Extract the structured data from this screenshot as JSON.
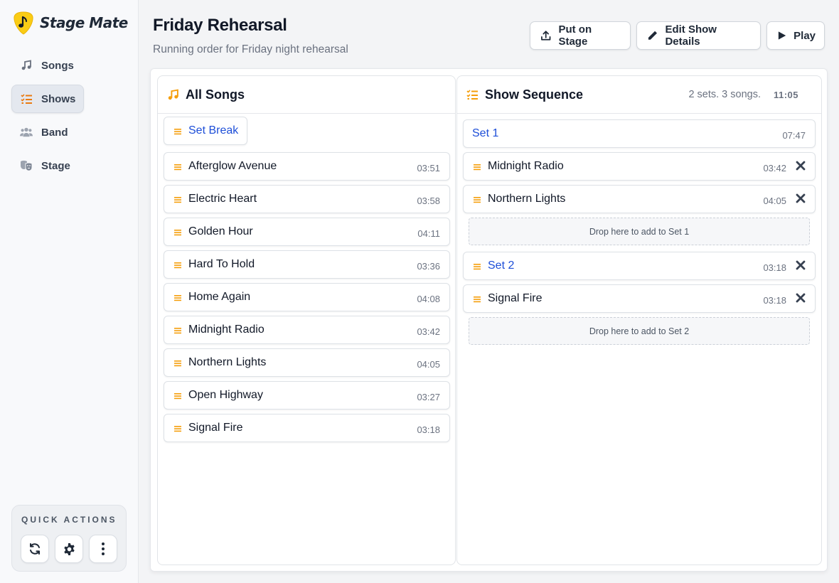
{
  "app": {
    "name": "Stage Mate"
  },
  "sidebar": {
    "items": [
      {
        "label": "Songs",
        "icon": "music-note-icon",
        "active": false
      },
      {
        "label": "Shows",
        "icon": "list-check-icon",
        "active": true
      },
      {
        "label": "Band",
        "icon": "users-icon",
        "active": false
      },
      {
        "label": "Stage",
        "icon": "theater-masks-icon",
        "active": false
      }
    ],
    "quick_actions": {
      "title": "QUICK ACTIONS",
      "buttons": [
        "refresh-icon",
        "gear-icon",
        "more-vertical-icon"
      ]
    }
  },
  "header": {
    "title": "Friday Rehearsal",
    "subtitle": "Running order for Friday night rehearsal",
    "buttons": [
      {
        "label": "Put on Stage",
        "icon": "upload-icon"
      },
      {
        "label": "Edit Show Details",
        "icon": "pencil-icon"
      },
      {
        "label": "Play",
        "icon": "play-icon"
      }
    ]
  },
  "all_songs": {
    "title": "All Songs",
    "set_break_label": "Set Break",
    "songs": [
      {
        "title": "Afterglow Avenue",
        "duration": "03:51"
      },
      {
        "title": "Electric Heart",
        "duration": "03:58"
      },
      {
        "title": "Golden Hour",
        "duration": "04:11"
      },
      {
        "title": "Hard To Hold",
        "duration": "03:36"
      },
      {
        "title": "Home Again",
        "duration": "04:08"
      },
      {
        "title": "Midnight Radio",
        "duration": "03:42"
      },
      {
        "title": "Northern Lights",
        "duration": "04:05"
      },
      {
        "title": "Open Highway",
        "duration": "03:27"
      },
      {
        "title": "Signal Fire",
        "duration": "03:18"
      }
    ]
  },
  "show_sequence": {
    "title": "Show Sequence",
    "summary": "2 sets. 3 songs.",
    "total": "11:05",
    "sets": [
      {
        "label": "Set 1",
        "duration": "07:47",
        "songs": [
          {
            "title": "Midnight Radio",
            "duration": "03:42"
          },
          {
            "title": "Northern Lights",
            "duration": "04:05"
          }
        ],
        "drop_hint": "Drop here to add to Set 1"
      },
      {
        "label": "Set 2",
        "duration": "03:18",
        "songs": [
          {
            "title": "Signal Fire",
            "duration": "03:18"
          }
        ],
        "drop_hint": "Drop here to add to Set 2"
      }
    ]
  },
  "colors": {
    "accent_orange": "#f59e0b",
    "link_blue": "#1d4ed8",
    "brand_yellow": "#facc15"
  }
}
